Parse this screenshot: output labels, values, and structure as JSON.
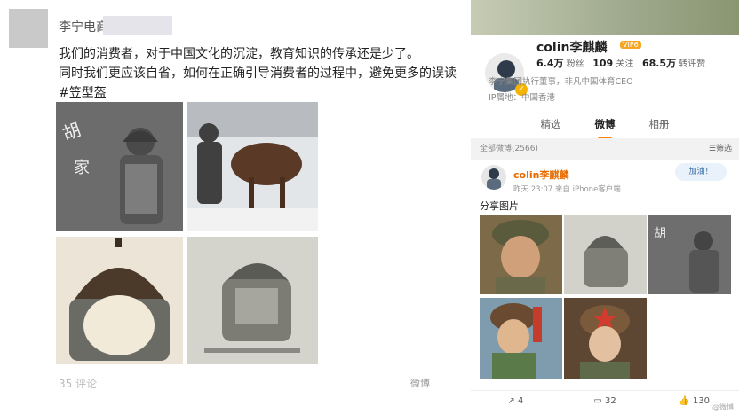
{
  "left": {
    "author": "李宁电商",
    "lines": [
      "我们的消费者，对于中国文化的沉淀，教育知识的传承还是少了。",
      "同时我们更应该自省，如何在正确引导消费者的过程中，避免更多的误读"
    ],
    "hashtag_prefix": "#",
    "hashtag": "笠型盔",
    "footer": "35 评论",
    "watermark": "微博"
  },
  "right": {
    "profile": {
      "name": "colin李麒麟",
      "vip": "VIP6",
      "verified_mark": "✓",
      "stats": [
        {
          "value": "6.4万",
          "label": "粉丝"
        },
        {
          "value": "109",
          "label": "关注"
        },
        {
          "value": "68.5万",
          "label": "转评赞"
        }
      ],
      "desc_lines": [
        "李宁集团执行董事，非凡中国体育CEO",
        "IP属地：中国香港"
      ],
      "tabs": [
        "精选",
        "微博",
        "相册"
      ],
      "active_tab": "微博"
    },
    "all_posts_label": "全部微博(2566)",
    "filter_label": "筛选",
    "post": {
      "author": "colin李麒麟",
      "time_source": "昨天 23:07  来自 iPhone客户端",
      "text": "分享图片",
      "sticker": "加油！",
      "actions": [
        {
          "icon": "share-icon",
          "label": "4"
        },
        {
          "icon": "comment-icon",
          "label": "32"
        },
        {
          "icon": "like-icon",
          "label": "130"
        }
      ]
    },
    "watermark": "@微博"
  },
  "colors": {
    "accent": "#ff8200",
    "name_orange": "#e86b00"
  }
}
